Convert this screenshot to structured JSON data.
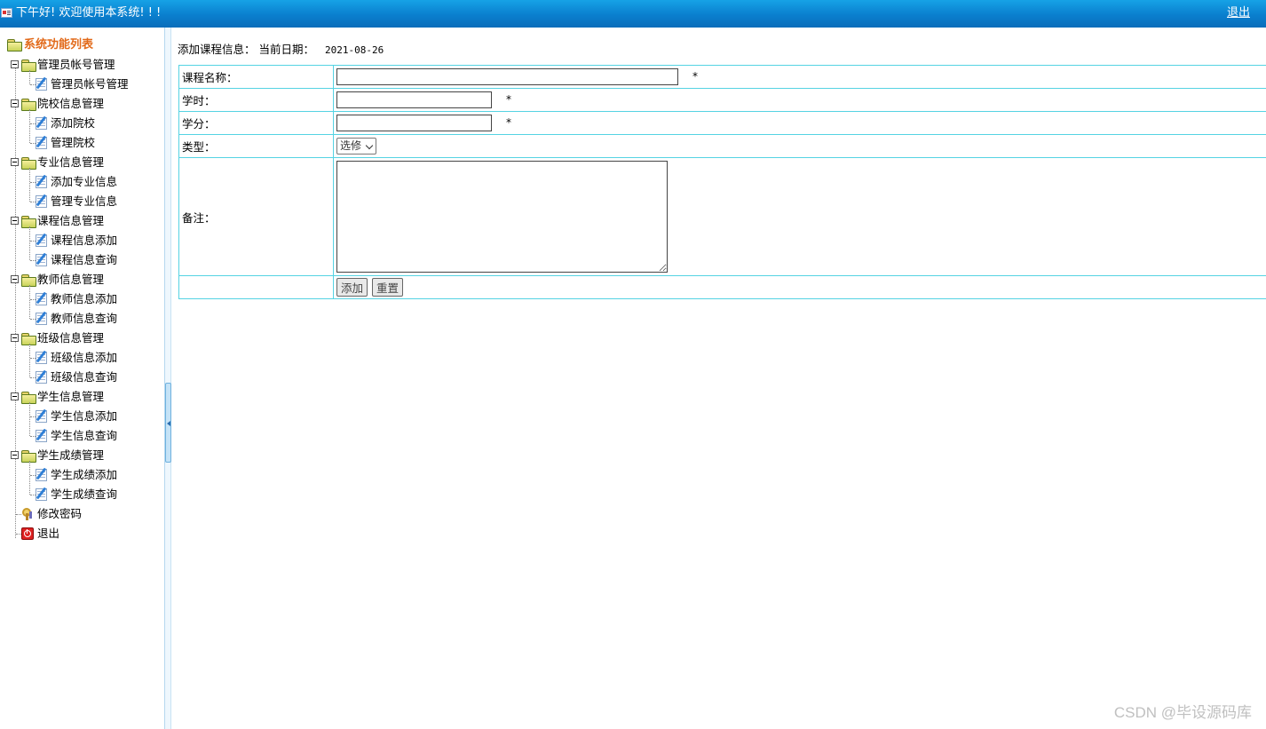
{
  "header": {
    "greeting": "下午好! 欢迎使用本系统! ! !",
    "logout_label": "退出"
  },
  "sidebar": {
    "root_label": "系统功能列表",
    "groups": [
      {
        "label": "管理员帐号管理",
        "items": [
          "管理员帐号管理"
        ]
      },
      {
        "label": "院校信息管理",
        "items": [
          "添加院校",
          "管理院校"
        ]
      },
      {
        "label": "专业信息管理",
        "items": [
          "添加专业信息",
          "管理专业信息"
        ]
      },
      {
        "label": "课程信息管理",
        "items": [
          "课程信息添加",
          "课程信息查询"
        ]
      },
      {
        "label": "教师信息管理",
        "items": [
          "教师信息添加",
          "教师信息查询"
        ]
      },
      {
        "label": "班级信息管理",
        "items": [
          "班级信息添加",
          "班级信息查询"
        ]
      },
      {
        "label": "学生信息管理",
        "items": [
          "学生信息添加",
          "学生信息查询"
        ]
      },
      {
        "label": "学生成绩管理",
        "items": [
          "学生成绩添加",
          "学生成绩查询"
        ]
      }
    ],
    "change_password_label": "修改密码",
    "exit_label": "退出"
  },
  "main": {
    "title": "添加课程信息：",
    "date_label": "当前日期：",
    "date_value": "2021-08-26",
    "form": {
      "course_name_label": "课程名称：",
      "course_name_value": "",
      "hours_label": "学时：",
      "hours_value": "",
      "credit_label": "学分：",
      "credit_value": "",
      "type_label": "类型：",
      "type_selected": "选修",
      "remark_label": "备注：",
      "remark_value": "",
      "required_mark": "*",
      "submit_label": "添加",
      "reset_label": "重置"
    }
  },
  "watermark": "CSDN @毕设源码库",
  "colors": {
    "topbar": "#0a7fce",
    "root_label": "#e26a1a",
    "table_border": "#55d3e3"
  }
}
